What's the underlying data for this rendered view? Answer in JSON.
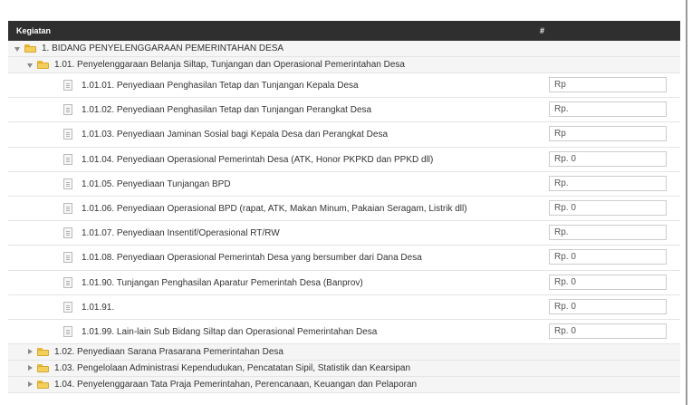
{
  "header": {
    "kegiatan": "Kegiatan",
    "hash": "#"
  },
  "tree": {
    "bidang": {
      "label": "1. BIDANG PENYELENGGARAAN PEMERINTAHAN DESA"
    },
    "sub": {
      "label": "1.01. Penyelenggaraan Belanja Siltap, Tunjangan dan Operasional Pemerintahan Desa"
    },
    "items": [
      {
        "label": "1.01.01. Penyediaan Penghasilan Tetap dan Tunjangan Kepala Desa",
        "amount": "Rp"
      },
      {
        "label": "1.01.02. Penyediaan Penghasilan Tetap dan Tunjangan Perangkat Desa",
        "amount": "Rp."
      },
      {
        "label": "1.01.03. Penyediaan Jaminan Sosial bagi Kepala Desa dan Perangkat Desa",
        "amount": "Rp"
      },
      {
        "label": "1.01.04. Penyediaan Operasional Pemerintah Desa (ATK, Honor PKPKD dan PPKD dll)",
        "amount": "Rp. 0"
      },
      {
        "label": "1.01.05. Penyediaan Tunjangan BPD",
        "amount": "Rp."
      },
      {
        "label": "1.01.06. Penyediaan Operasional BPD (rapat, ATK, Makan Minum, Pakaian Seragam, Listrik dll)",
        "amount": "Rp. 0"
      },
      {
        "label": "1.01.07. Penyediaan Insentif/Operasional RT/RW",
        "amount": "Rp."
      },
      {
        "label": "1.01.08. Penyediaan Operasional Pemerintah Desa yang bersumber dari Dana Desa",
        "amount": "Rp. 0"
      },
      {
        "label": "1.01.90. Tunjangan Penghasilan Aparatur Pemerintah Desa (Banprov)",
        "amount": "Rp. 0"
      },
      {
        "label": "1.01.91.",
        "amount": "Rp. 0"
      },
      {
        "label": "1.01.99. Lain-lain Sub Bidang Siltap dan Operasional Pemerintahan Desa",
        "amount": "Rp. 0"
      }
    ],
    "collapsed": [
      {
        "label": "1.02. Penyediaan Sarana Prasarana Pemerintahan Desa"
      },
      {
        "label": "1.03. Pengelolaan Administrasi Kependudukan, Pencatatan Sipil, Statistik dan Kearsipan"
      },
      {
        "label": "1.04. Penyelenggaraan Tata Praja Pemerintahan, Perencanaan, Keuangan dan Pelaporan"
      }
    ]
  },
  "colors": {
    "header_bg": "#2f2f2f",
    "folder": "#f2cf5b",
    "row_shade": "#f5f5f5"
  },
  "icons": {
    "expanded": "caret-down-icon",
    "collapsed": "caret-right-icon",
    "folder": "folder-icon",
    "leaf": "document-icon"
  }
}
